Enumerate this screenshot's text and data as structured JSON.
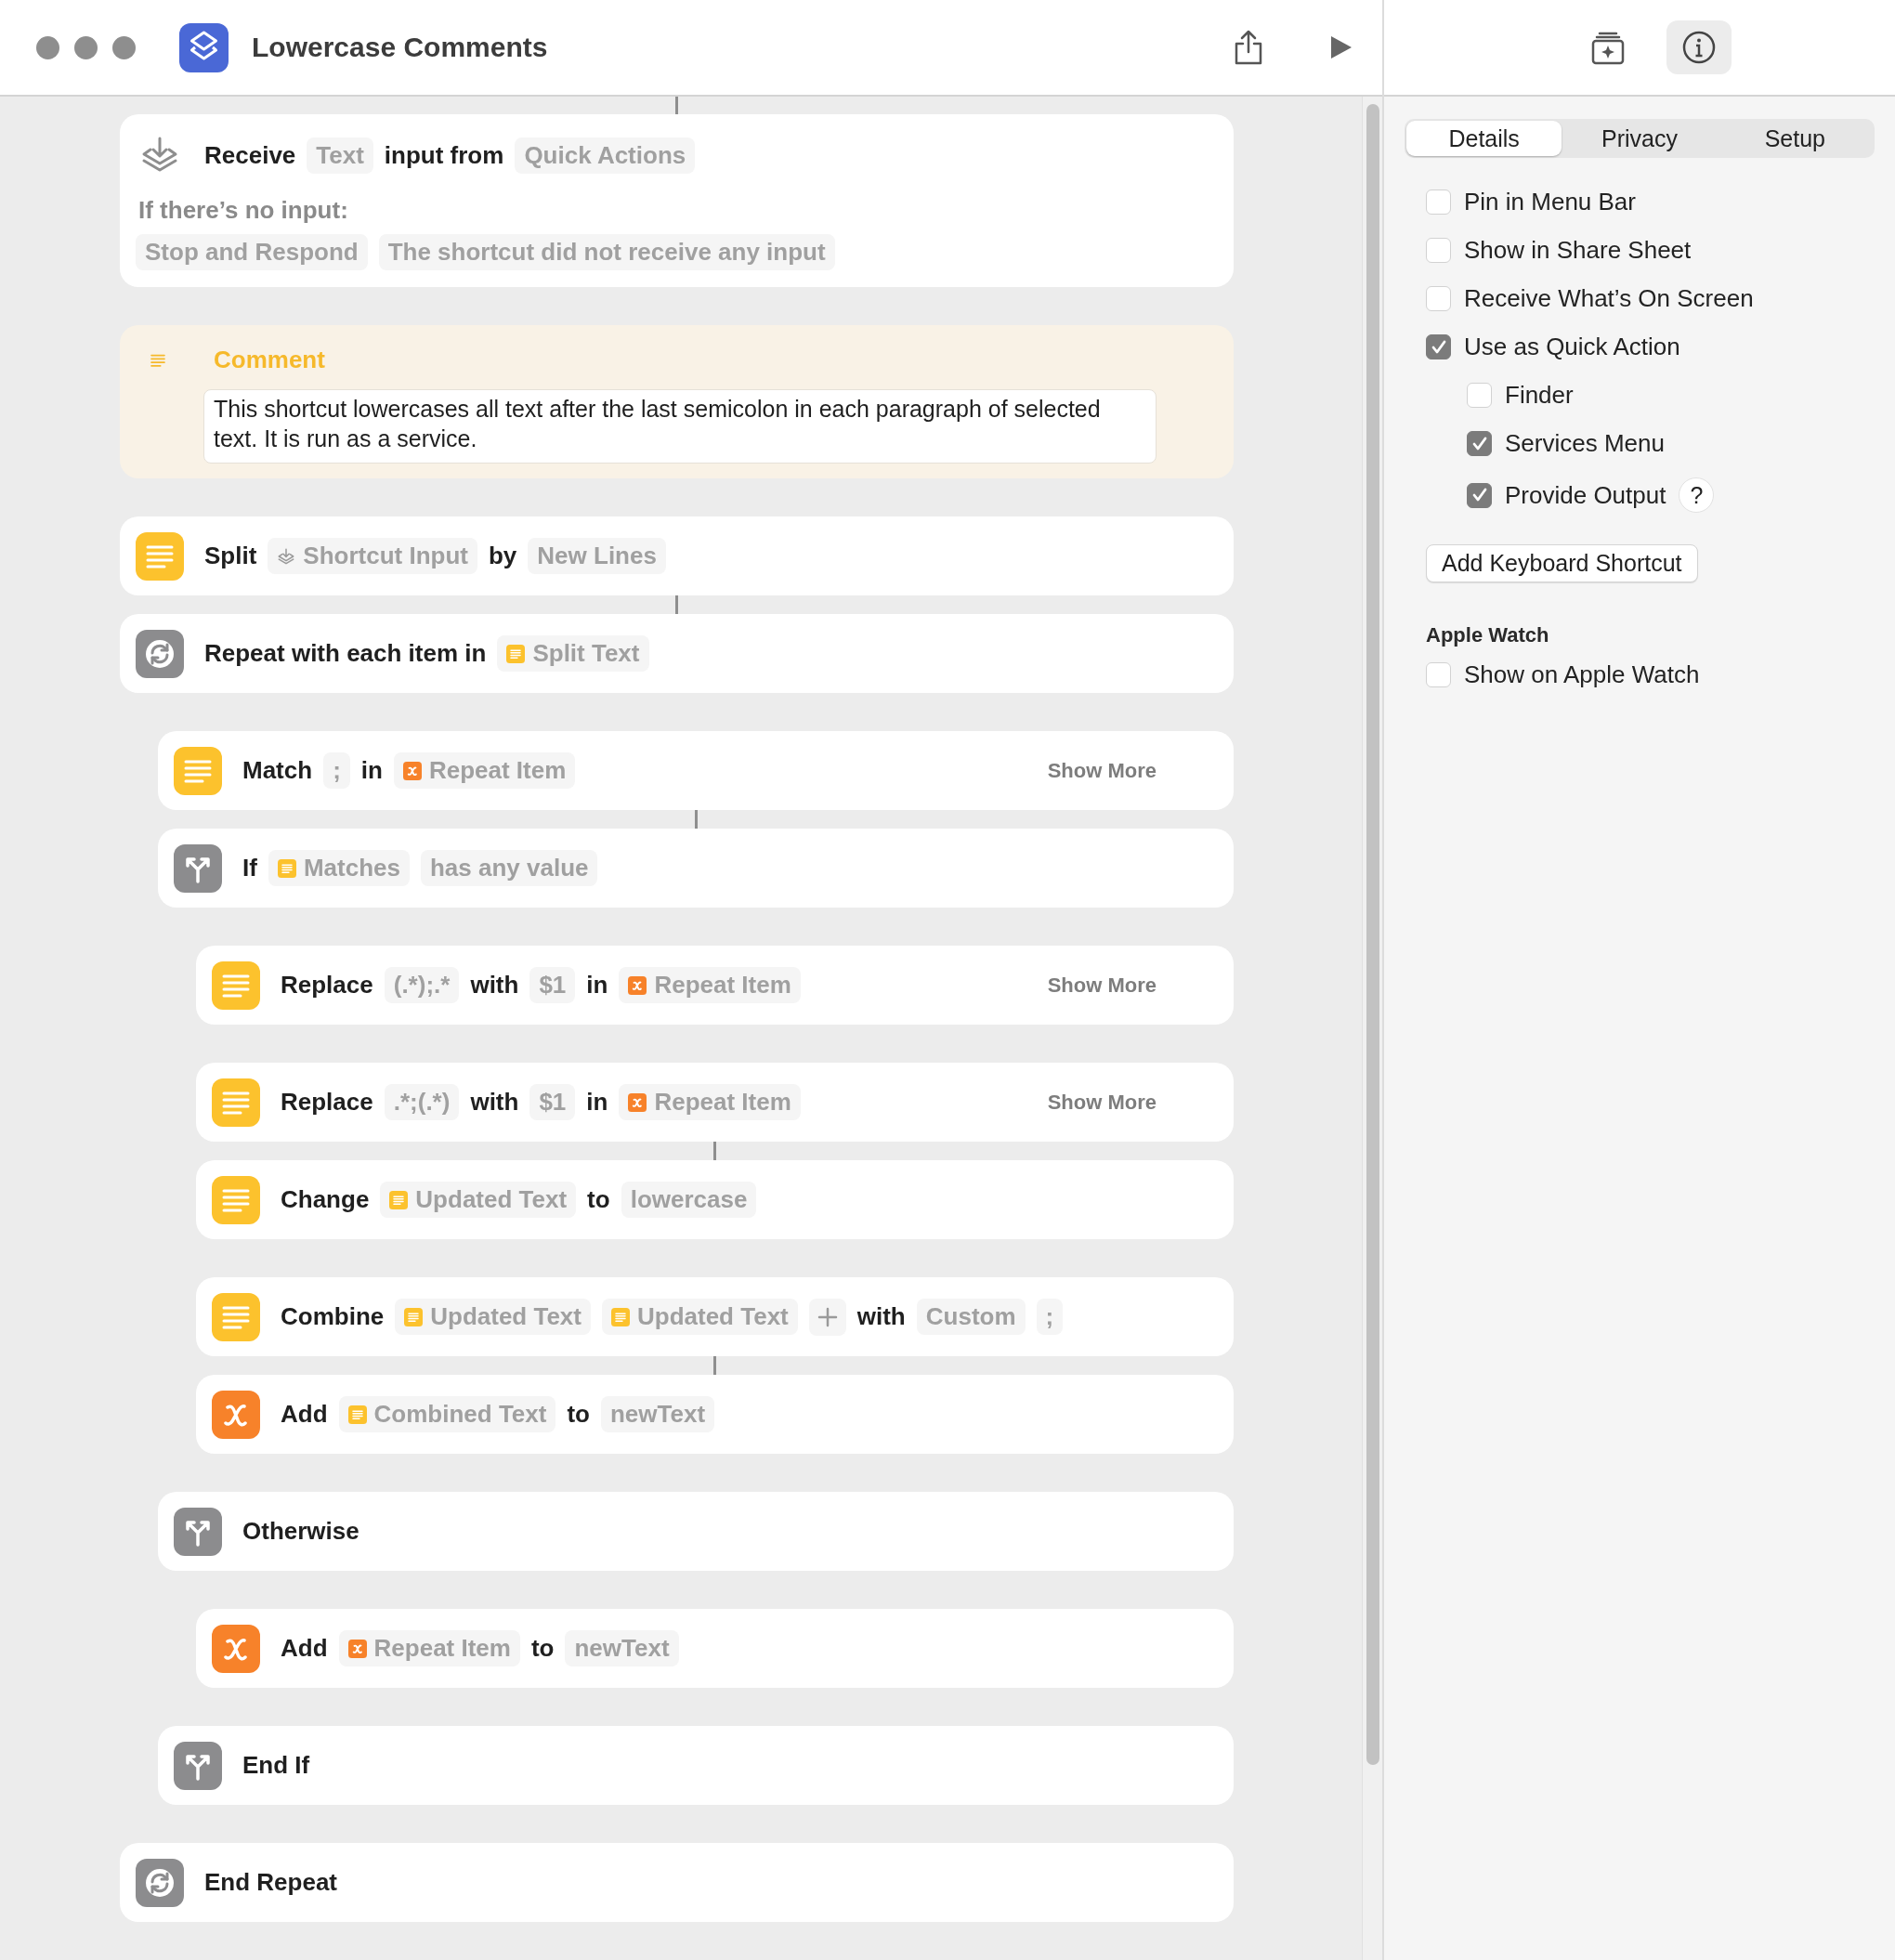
{
  "window": {
    "title": "Lowercase Comments"
  },
  "inspector_buttons": [
    {
      "kind": "gallery",
      "selected": false
    },
    {
      "kind": "info",
      "selected": true
    }
  ],
  "actions": [
    {
      "kind": "receive",
      "connector": false,
      "parts": [
        {
          "kind": "word",
          "text": "Receive"
        },
        {
          "kind": "token",
          "text": "Text"
        },
        {
          "kind": "word",
          "text": "input from"
        },
        {
          "kind": "token",
          "text": "Quick Actions"
        }
      ],
      "fallback_label": "If there’s no input:",
      "fallback": [
        {
          "kind": "token",
          "text": "Stop and Respond"
        },
        {
          "kind": "token",
          "text": "The shortcut did not receive any input"
        }
      ]
    },
    {
      "kind": "comment",
      "connector": false,
      "title": "Comment",
      "text": "This shortcut lowercases all text after the last semicolon in each paragraph of selected text. It is run as a service."
    },
    {
      "kind": "text",
      "connector": true,
      "parts": [
        {
          "kind": "word",
          "text": "Split"
        },
        {
          "kind": "input-token",
          "text": "Shortcut Input"
        },
        {
          "kind": "word",
          "text": "by"
        },
        {
          "kind": "token",
          "text": "New Lines"
        }
      ]
    },
    {
      "kind": "repeat",
      "connector": false,
      "parts": [
        {
          "kind": "word",
          "text": "Repeat with each item in"
        },
        {
          "kind": "text-token",
          "text": "Split Text"
        }
      ],
      "children": [
        {
          "kind": "text",
          "connector": true,
          "show_more": "Show More",
          "parts": [
            {
              "kind": "word",
              "text": "Match"
            },
            {
              "kind": "token",
              "text": ";"
            },
            {
              "kind": "word",
              "text": "in"
            },
            {
              "kind": "variable-token",
              "text": "Repeat Item"
            }
          ]
        },
        {
          "kind": "branch",
          "connector": false,
          "parts": [
            {
              "kind": "word",
              "text": "If"
            },
            {
              "kind": "text-token",
              "text": "Matches"
            },
            {
              "kind": "token",
              "text": "has any value"
            }
          ],
          "children": [
            {
              "kind": "text",
              "connector": false,
              "show_more": "Show More",
              "parts": [
                {
                  "kind": "word",
                  "text": "Replace"
                },
                {
                  "kind": "token",
                  "text": "(.*);.*"
                },
                {
                  "kind": "word",
                  "text": "with"
                },
                {
                  "kind": "token",
                  "text": "$1"
                },
                {
                  "kind": "word",
                  "text": "in"
                },
                {
                  "kind": "variable-token",
                  "text": "Repeat Item"
                }
              ]
            },
            {
              "kind": "text",
              "connector": true,
              "show_more": "Show More",
              "parts": [
                {
                  "kind": "word",
                  "text": "Replace"
                },
                {
                  "kind": "token",
                  "text": ".*;(.*)"
                },
                {
                  "kind": "word",
                  "text": "with"
                },
                {
                  "kind": "token",
                  "text": "$1"
                },
                {
                  "kind": "word",
                  "text": "in"
                },
                {
                  "kind": "variable-token",
                  "text": "Repeat Item"
                }
              ]
            },
            {
              "kind": "text",
              "connector": false,
              "parts": [
                {
                  "kind": "word",
                  "text": "Change"
                },
                {
                  "kind": "text-token",
                  "text": "Updated Text"
                },
                {
                  "kind": "word",
                  "text": "to"
                },
                {
                  "kind": "token",
                  "text": "lowercase"
                }
              ]
            },
            {
              "kind": "text",
              "connector": true,
              "parts": [
                {
                  "kind": "word",
                  "text": "Combine"
                },
                {
                  "kind": "text-token",
                  "text": "Updated Text"
                },
                {
                  "kind": "text-token",
                  "text": "Updated Text"
                },
                {
                  "kind": "plus"
                },
                {
                  "kind": "word",
                  "text": "with"
                },
                {
                  "kind": "token",
                  "text": "Custom"
                },
                {
                  "kind": "token",
                  "text": ";"
                }
              ]
            },
            {
              "kind": "variable",
              "connector": false,
              "parts": [
                {
                  "kind": "word",
                  "text": "Add"
                },
                {
                  "kind": "text-token",
                  "text": "Combined Text"
                },
                {
                  "kind": "word",
                  "text": "to"
                },
                {
                  "kind": "token",
                  "text": "newText"
                }
              ]
            }
          ]
        },
        {
          "kind": "branch",
          "connector": false,
          "parts": [
            {
              "kind": "word",
              "text": "Otherwise"
            }
          ],
          "children": [
            {
              "kind": "variable",
              "connector": false,
              "parts": [
                {
                  "kind": "word",
                  "text": "Add"
                },
                {
                  "kind": "variable-token",
                  "text": "Repeat Item"
                },
                {
                  "kind": "word",
                  "text": "to"
                },
                {
                  "kind": "token",
                  "text": "newText"
                }
              ]
            }
          ]
        },
        {
          "kind": "branch",
          "connector": false,
          "parts": [
            {
              "kind": "word",
              "text": "End If"
            }
          ]
        }
      ]
    },
    {
      "kind": "repeat",
      "connector": false,
      "parts": [
        {
          "kind": "word",
          "text": "End Repeat"
        }
      ]
    }
  ],
  "inspector": {
    "tabs": [
      {
        "label": "Details",
        "selected": true
      },
      {
        "label": "Privacy",
        "selected": false
      },
      {
        "label": "Setup",
        "selected": false
      }
    ],
    "options": [
      {
        "label": "Pin in Menu Bar",
        "checked": false
      },
      {
        "label": "Show in Share Sheet",
        "checked": false
      },
      {
        "label": "Receive What’s On Screen",
        "checked": false
      },
      {
        "label": "Use as Quick Action",
        "checked": true,
        "children": [
          {
            "label": "Finder",
            "checked": false
          },
          {
            "label": "Services Menu",
            "checked": true
          },
          {
            "label": "Provide Output",
            "checked": true,
            "help": "?"
          }
        ]
      }
    ],
    "button": "Add Keyboard Shortcut",
    "section": {
      "title": "Apple Watch",
      "options": [
        {
          "label": "Show on Apple Watch",
          "checked": false
        }
      ]
    }
  }
}
